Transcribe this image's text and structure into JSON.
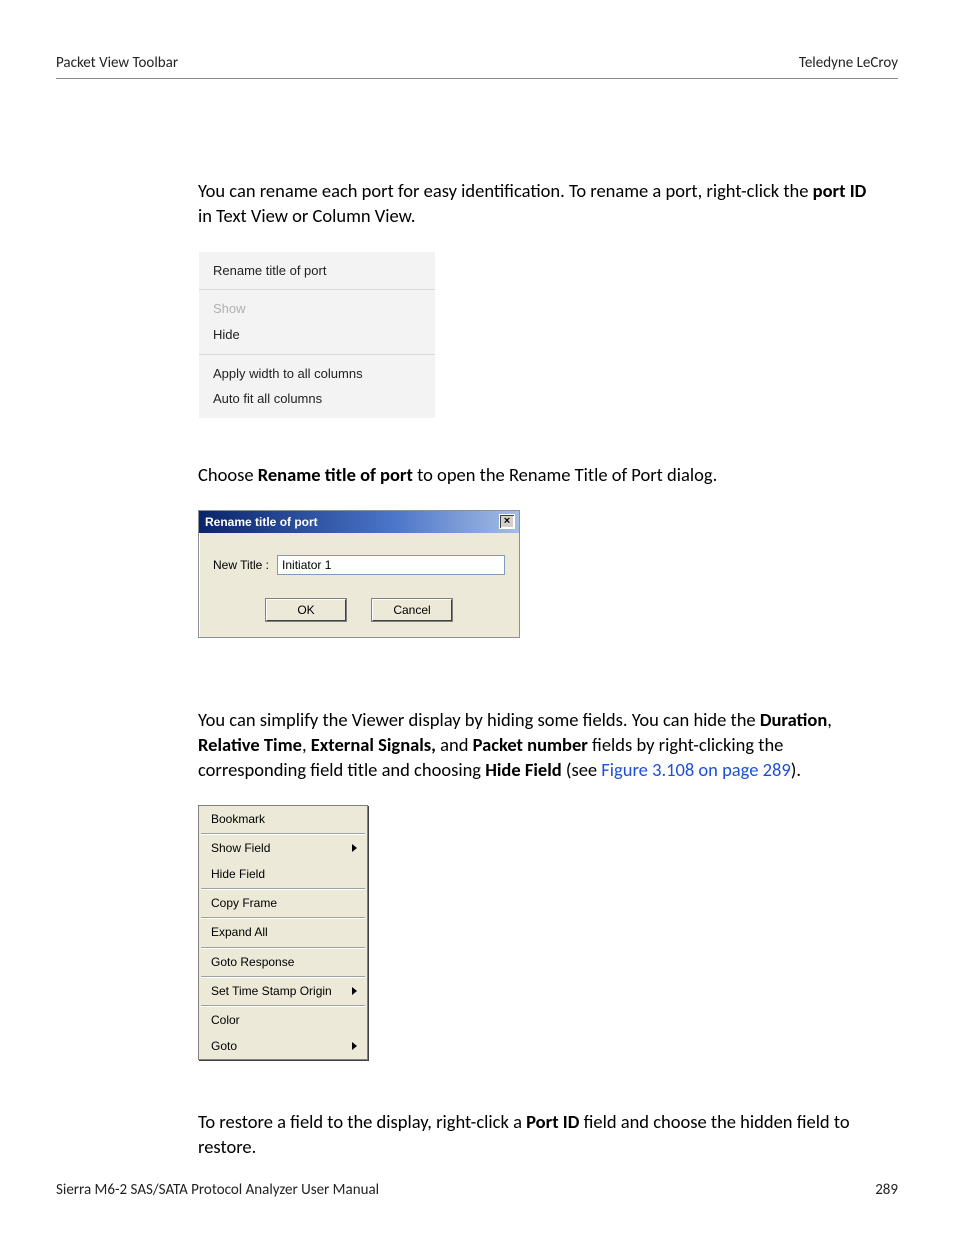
{
  "header": {
    "left": "Packet View Toolbar",
    "right": "Teledyne LeCroy"
  },
  "para1": {
    "a": "You can rename each port for easy identification. To rename a port, right-click the ",
    "b": "port ID",
    "c": " in Text View or Column View."
  },
  "menu1": {
    "rename": "Rename title of port",
    "show": "Show",
    "hide": "Hide",
    "applyWidth": "Apply width to all columns",
    "autoFit": "Auto fit all columns"
  },
  "para2": {
    "a": "Choose ",
    "b": "Rename title of port",
    "c": " to open the Rename Title of Port dialog."
  },
  "dialog": {
    "title": "Rename title of port",
    "close": "×",
    "label": "New Title :",
    "value": "Initiator 1",
    "ok": "OK",
    "cancel": "Cancel"
  },
  "para3": {
    "a": "You can simplify the Viewer display by hiding some fields. You can hide the ",
    "b": "Duration",
    "c": ", ",
    "d": "Relative Time",
    "e": ", ",
    "f": "External Signals,",
    "g": " and ",
    "h": "Packet number",
    "i": " fields by right-clicking the corresponding field title and choosing ",
    "j": "Hide Field",
    "k": " (see ",
    "l": "Figure 3.108 on page 289",
    "m": ")."
  },
  "menu2": {
    "bookmark": "Bookmark",
    "showField": "Show Field",
    "hideField": "Hide Field",
    "copyFrame": "Copy Frame",
    "expandAll": "Expand All",
    "gotoResponse": "Goto Response",
    "setTimeStamp": "Set Time Stamp Origin",
    "color": "Color",
    "goto": "Goto"
  },
  "para4": {
    "a": "To restore a field to the display, right-click a ",
    "b": "Port ID",
    "c": " field and choose the hidden field to restore."
  },
  "footer": {
    "left": "Sierra M6-2 SAS/SATA Protocol Analyzer User Manual",
    "right": "289"
  }
}
